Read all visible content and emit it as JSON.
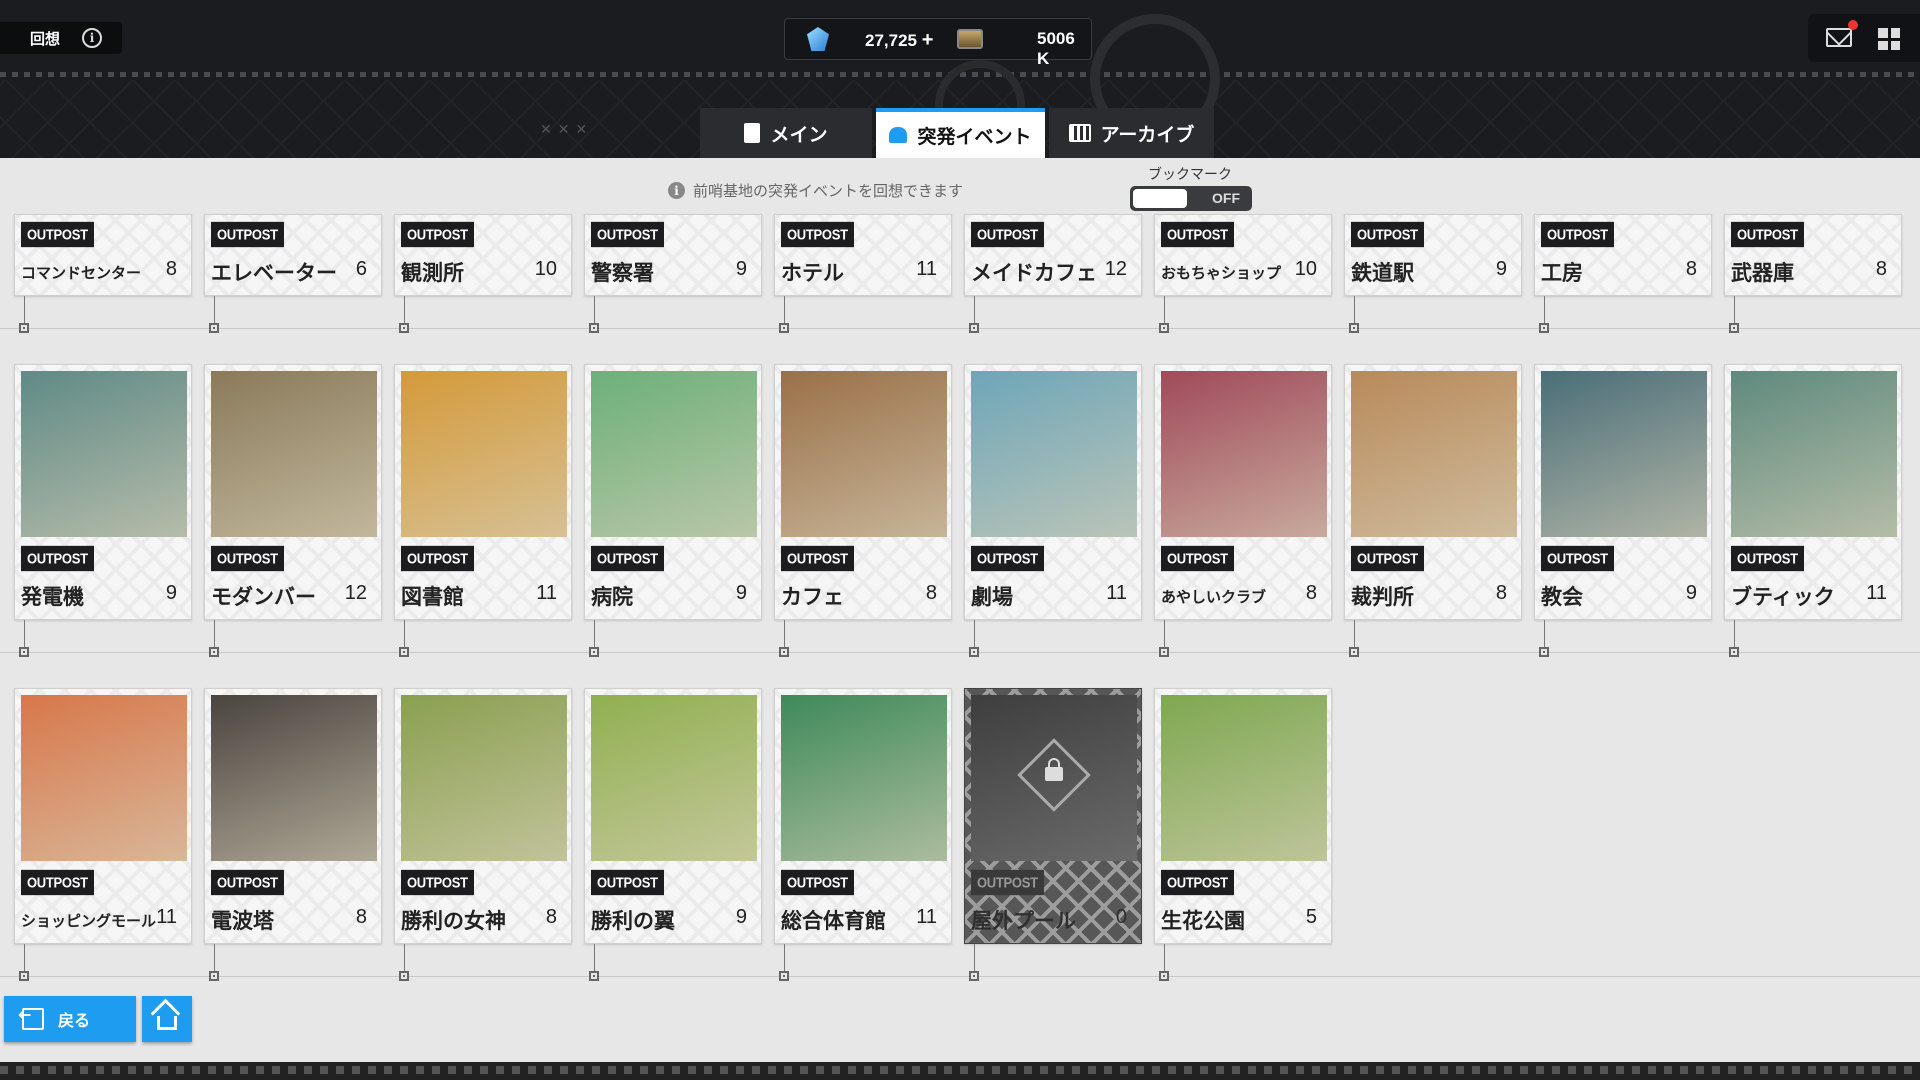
{
  "header": {
    "title": "回想",
    "currency_gems": "27,725",
    "currency_plus": "+",
    "currency_credits": "5006 K"
  },
  "tabs": [
    {
      "label": "メイン",
      "active": false
    },
    {
      "label": "突発イベント",
      "active": true
    },
    {
      "label": "アーカイブ",
      "active": false
    }
  ],
  "notice": "前哨基地の突発イベントを回想できます",
  "bookmark": {
    "label": "ブックマーク",
    "state": "OFF"
  },
  "tag_label": "OUTPOST",
  "cards_row1": [
    {
      "name": "コマンドセンター",
      "count": "8"
    },
    {
      "name": "エレベーター",
      "count": "6"
    },
    {
      "name": "観測所",
      "count": "10"
    },
    {
      "name": "警察署",
      "count": "9"
    },
    {
      "name": "ホテル",
      "count": "11"
    },
    {
      "name": "メイドカフェ",
      "count": "12"
    },
    {
      "name": "おもちゃショップ",
      "count": "10"
    },
    {
      "name": "鉄道駅",
      "count": "9"
    },
    {
      "name": "工房",
      "count": "8"
    },
    {
      "name": "武器庫",
      "count": "8"
    }
  ],
  "cards_row2": [
    {
      "name": "発電機",
      "count": "9",
      "color": "#5f8a86"
    },
    {
      "name": "モダンバー",
      "count": "12",
      "color": "#8a7a5a"
    },
    {
      "name": "図書館",
      "count": "11",
      "color": "#d49a3a"
    },
    {
      "name": "病院",
      "count": "9",
      "color": "#6cb07a"
    },
    {
      "name": "カフェ",
      "count": "8",
      "color": "#9a7048"
    },
    {
      "name": "劇場",
      "count": "11",
      "color": "#6ea6b8"
    },
    {
      "name": "あやしいクラブ",
      "count": "8",
      "color": "#a04a5a"
    },
    {
      "name": "裁判所",
      "count": "8",
      "color": "#b88a5a"
    },
    {
      "name": "教会",
      "count": "9",
      "color": "#4a6e78"
    },
    {
      "name": "ブティック",
      "count": "11",
      "color": "#5e8a7e"
    }
  ],
  "cards_row3": [
    {
      "name": "ショッピングモール",
      "count": "11",
      "color": "#d8774a",
      "locked": false
    },
    {
      "name": "電波塔",
      "count": "8",
      "color": "#4a4440",
      "locked": false
    },
    {
      "name": "勝利の女神",
      "count": "8",
      "color": "#8aa050",
      "locked": false
    },
    {
      "name": "勝利の翼",
      "count": "9",
      "color": "#90b050",
      "locked": false
    },
    {
      "name": "総合体育館",
      "count": "11",
      "color": "#3e8a5a",
      "locked": false
    },
    {
      "name": "屋外プール",
      "count": "0",
      "color": "#4a4a4a",
      "locked": true
    },
    {
      "name": "生花公園",
      "count": "5",
      "color": "#7ea850",
      "locked": false
    }
  ],
  "buttons": {
    "back": "戻る"
  }
}
